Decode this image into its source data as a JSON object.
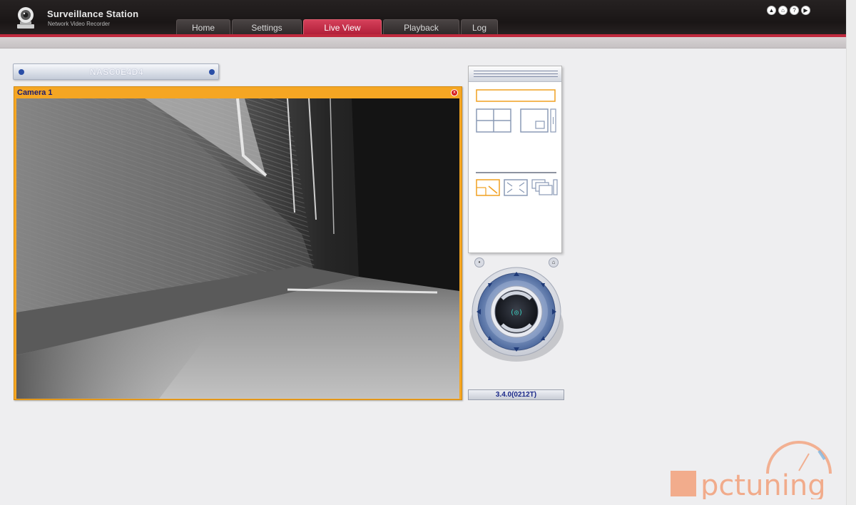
{
  "app": {
    "title": "Surveillance Station",
    "subtitle": "Network Video Recorder"
  },
  "tabs": [
    {
      "label": "Home",
      "active": false
    },
    {
      "label": "Settings",
      "active": false
    },
    {
      "label": "Live View",
      "active": true
    },
    {
      "label": "Playback",
      "active": false
    },
    {
      "label": "Log",
      "active": false
    }
  ],
  "top_icons": [
    {
      "icon": "logout-icon",
      "glyph": "▲"
    },
    {
      "icon": "home-icon",
      "glyph": "⌂"
    },
    {
      "icon": "help-icon",
      "glyph": "?"
    },
    {
      "icon": "forward-icon",
      "glyph": "▶"
    }
  ],
  "server": {
    "name": "NASC0E4D4"
  },
  "camera": {
    "name": "Camera 1",
    "close_glyph": "x"
  },
  "layout_panel": {
    "options": [
      "single-view",
      "quad-view",
      "picture-in-picture-view"
    ],
    "tools": [
      "zoom-to-selection",
      "fit-to-window",
      "multiple-windows"
    ]
  },
  "ptz": {
    "preset_glyph": "•",
    "home_glyph": "⌂"
  },
  "version": "3.4.0(0212T)",
  "watermark": {
    "text": "pctuning"
  },
  "colors": {
    "accent_red": "#c02a3e",
    "camera_border": "#f5a623",
    "server_dot": "#2a4ea6",
    "version_text": "#1c2a8a",
    "watermark_orange": "#f2a07a",
    "watermark_blue": "#7fb6e0"
  }
}
